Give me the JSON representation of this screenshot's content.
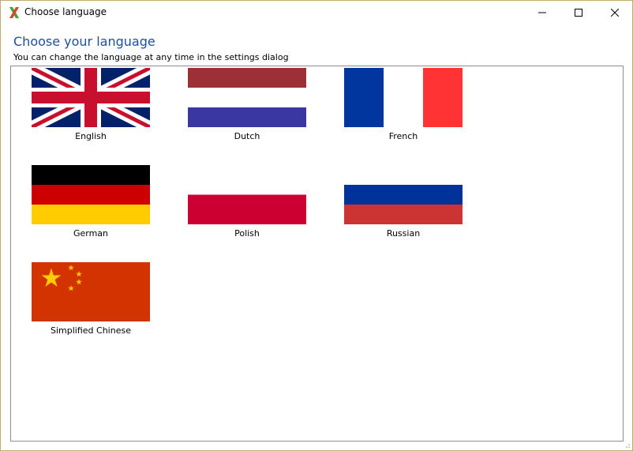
{
  "window": {
    "title": "Choose language",
    "icon": "app-x-icon",
    "controls": [
      "minimize-icon",
      "maximize-icon",
      "close-icon"
    ]
  },
  "header": {
    "heading": "Choose your language",
    "subheading": "You can change the language at any time in the settings dialog"
  },
  "languages": [
    {
      "label": "English",
      "flag": "uk-flag-icon",
      "colors": [
        "#012169",
        "#ffffff",
        "#c8102e"
      ]
    },
    {
      "label": "Dutch",
      "flag": "netherlands-flag-icon",
      "colors": [
        "#9c3036",
        "#ffffff",
        "#3b37a2"
      ]
    },
    {
      "label": "French",
      "flag": "france-flag-icon",
      "colors": [
        "#00369e",
        "#ffffff",
        "#ff3333"
      ]
    },
    {
      "label": "German",
      "flag": "germany-flag-icon",
      "colors": [
        "#000000",
        "#cc0000",
        "#ffcc00"
      ]
    },
    {
      "label": "Polish",
      "flag": "poland-flag-icon",
      "colors": [
        "#ffffff",
        "#cc0033"
      ]
    },
    {
      "label": "Russian",
      "flag": "russia-flag-icon",
      "colors": [
        "#ffffff",
        "#003399",
        "#cc3333"
      ]
    },
    {
      "label": "Simplified Chinese",
      "flag": "china-flag-icon",
      "colors": [
        "#d23300",
        "#ffcc00"
      ]
    }
  ],
  "colors": {
    "heading": "#1f4fa0",
    "window_border": "#c7a978",
    "panel_border": "#8d8d8d"
  }
}
